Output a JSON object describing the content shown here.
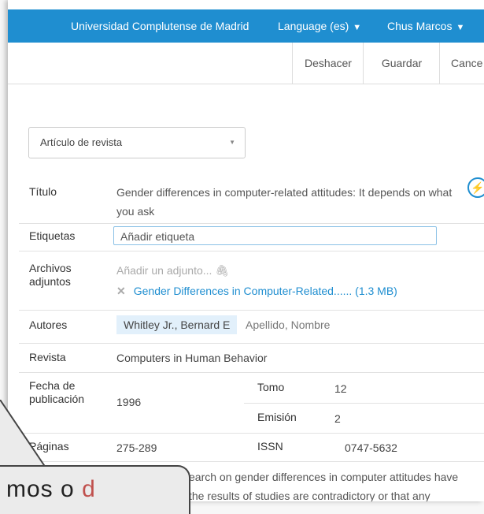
{
  "topbar": {
    "institution": "Universidad Complutense de Madrid",
    "language": "Language (es)",
    "user": "Chus Marcos",
    "caret": "▼"
  },
  "actions": {
    "undo": "Deshacer",
    "save": "Guardar",
    "cancel": "Cance"
  },
  "item_type": "Artículo de revista",
  "fields": {
    "title_label": "Título",
    "title_value": "Gender differences in computer-related attitudes: It depends on what you ask",
    "tags_label": "Etiquetas",
    "tags_placeholder": "Añadir etiqueta",
    "attachments_label": "Archivos adjuntos",
    "attachments_add": "Añadir un adjunto... 🖇",
    "attachment_file": "Gender Differences in Computer-Related...... (1.3 MB)",
    "authors_label": "Autores",
    "author_name": "Whitley Jr., Bernard E",
    "author_placeholder": "Apellido, Nombre",
    "journal_label": "Revista",
    "journal_value": "Computers in Human Behavior",
    "pubdate_label": "Fecha de publicación",
    "pubdate_value": "1996",
    "volume_label": "Tomo",
    "volume_value": "12",
    "issue_label": "Emisión",
    "issue_value": "2",
    "pages_label": "Páginas",
    "pages_value": "275-289",
    "issn_label": "ISSN",
    "issn_value": "0747-5632"
  },
  "abstract": {
    "line1": "earch on gender differences in computer attitudes have",
    "line2": "the results of studies are contradictory or that any"
  },
  "callout": {
    "text_a": "mos",
    "text_b": "o",
    "text_accent": "d"
  },
  "colors": {
    "brand": "#1f8ed0",
    "chip": "#e2f0fb"
  }
}
